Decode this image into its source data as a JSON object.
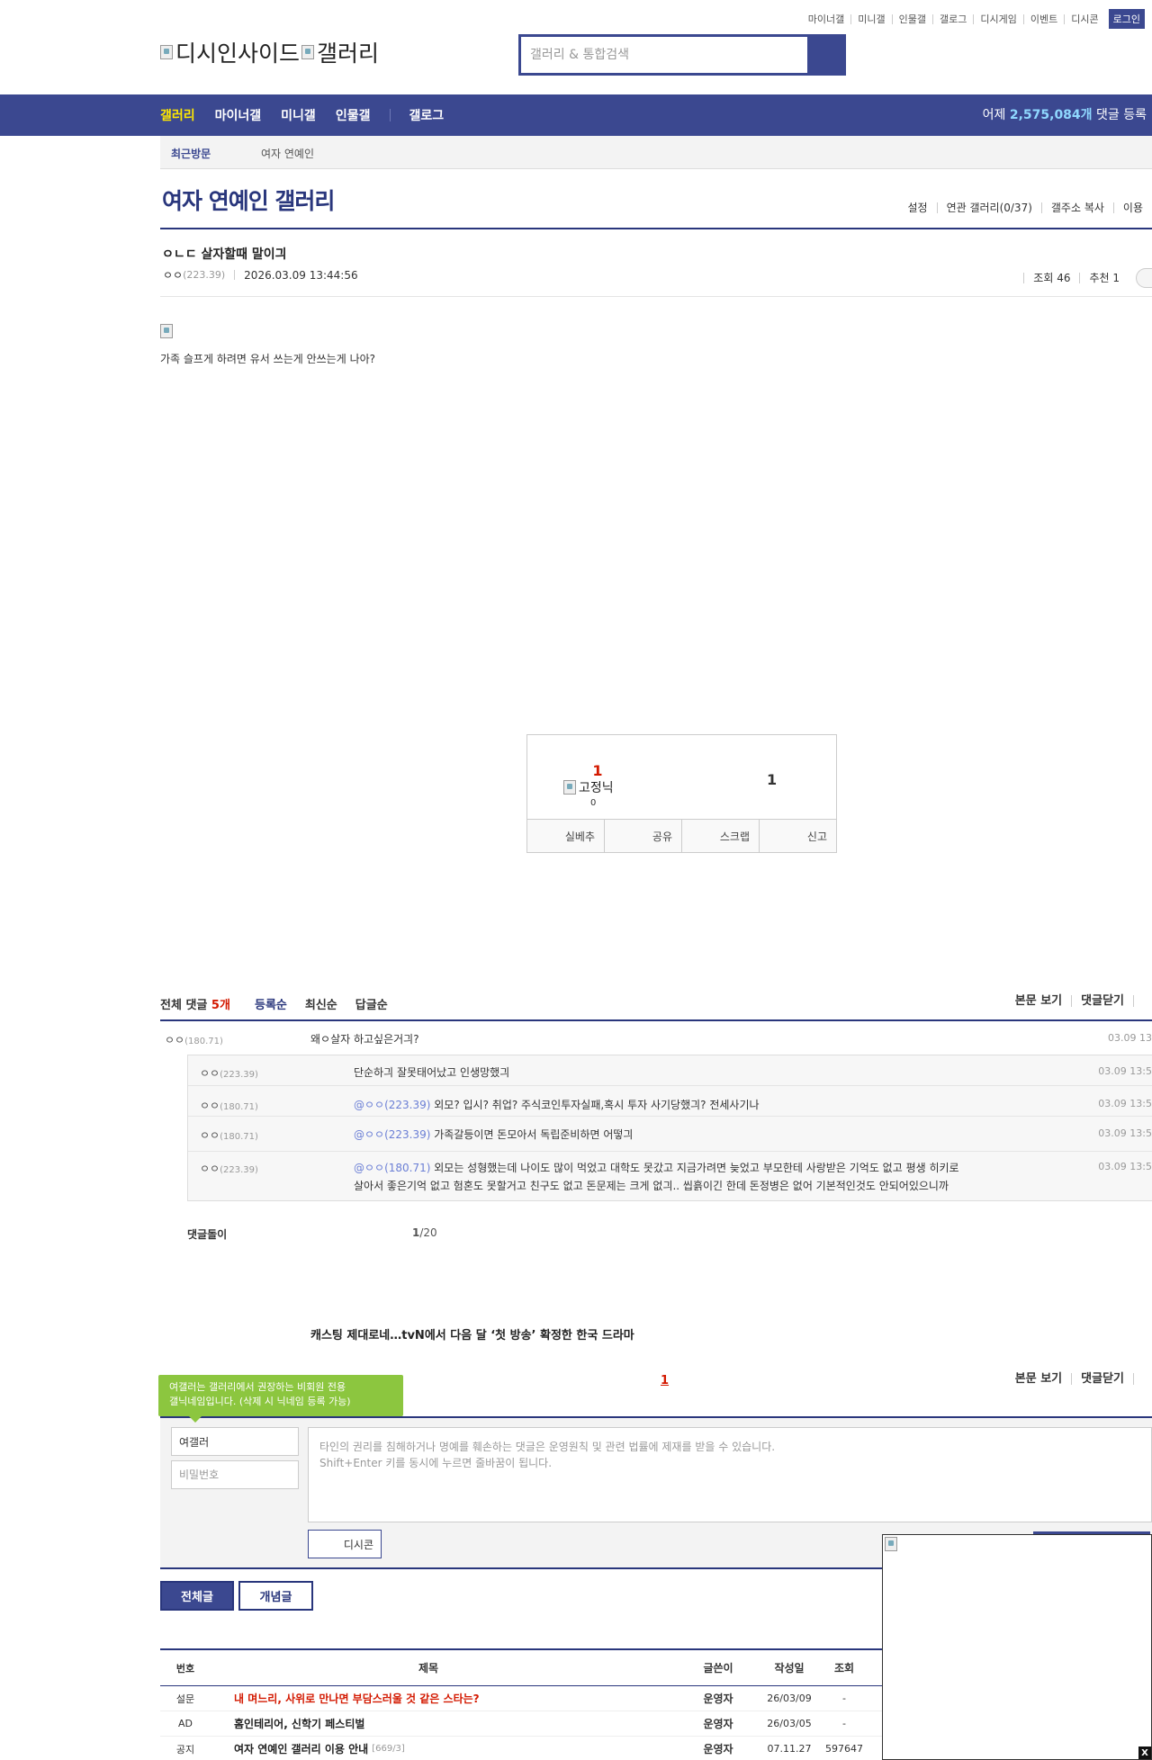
{
  "util_links": [
    "마이너갤",
    "미니갤",
    "인물갤",
    "갤로그",
    "디시게임",
    "이벤트",
    "디시콘"
  ],
  "login_label": "로그인",
  "logo": {
    "part1": "디시인사이드",
    "part2": "갤러리"
  },
  "search": {
    "placeholder": "갤러리 & 통합검색"
  },
  "gnb": {
    "menu": [
      "갤러리",
      "마이너갤",
      "미니갤",
      "인물갤"
    ],
    "gallog": "갤로그",
    "stat_prefix": "어제",
    "stat_num": "2,575,084개",
    "stat_suffix": "댓글 등록"
  },
  "recent": {
    "label": "최근방문",
    "item": "여자 연예인"
  },
  "gallery": {
    "title": "여자 연예인 갤러리",
    "tools": [
      "설정",
      "연관 갤러리(0/37)",
      "갤주소 복사",
      "이용"
    ]
  },
  "post": {
    "title": "ㅇㄴㄷ 살자할때 말이긔",
    "nick": "ㅇㅇ",
    "ip": "(223.39)",
    "date": "2026.03.09 13:44:56",
    "views": "조회 46",
    "recommend": "추천 1",
    "body": "가족 슬프게 하려면 유서 쓰는게 안쓰는게 나아?"
  },
  "rec": {
    "up": "1",
    "fix_alt": "고정닉",
    "fix_count": "0",
    "down": "1",
    "actions": [
      "실베추",
      "공유",
      "스크랩",
      "신고"
    ]
  },
  "comments_head": {
    "total_label": "전체 댓글",
    "total_count": "5개",
    "sort": [
      "등록순",
      "최신순",
      "답글순"
    ],
    "right": [
      "본문 보기",
      "댓글닫기"
    ]
  },
  "comments": [
    {
      "nick": "ㅇㅇ",
      "ip": "(180.71)",
      "text": "왜ㅇ살자 하고싶은거긔?",
      "date": "03.09 13"
    },
    {
      "nick": "ㅇㅇ",
      "ip": "(223.39)",
      "at": "",
      "text": "단순하긔 잘못태어났고 인생망했긔",
      "date": "03.09 13:5"
    },
    {
      "nick": "ㅇㅇ",
      "ip": "(180.71)",
      "at": "@ㅇㅇ(223.39)",
      "text": " 외모? 입시? 취업? 주식코인투자실패,혹시 투자 사기당했긔? 전세사기나",
      "date": "03.09 13:5"
    },
    {
      "nick": "ㅇㅇ",
      "ip": "(180.71)",
      "at": "@ㅇㅇ(223.39)",
      "text": " 가족갈등이면 돈모아서 독립준비하면 어떻긔",
      "date": "03.09 13:5"
    },
    {
      "nick": "ㅇㅇ",
      "ip": "(223.39)",
      "at": "@ㅇㅇ(180.71)",
      "text": " 외모는 성형했는데 나이도 많이 먹었고 대학도 못갔고 지금가려면 늦었고 부모한테 사랑받은 기억도 없고 평생 히키로",
      "text2": "살아서 좋은기억 없고 험혼도 못할거고 친구도 없고 돈문제는 크게 없긔.. 씹흙이긴 한데 돈정병은 없어 기본적인것도 안되어있으니까",
      "date": "03.09 13:5"
    }
  ],
  "cmt_paging": {
    "label": "댓글돌이",
    "current": "1",
    "total": "/20"
  },
  "news": "캐스팅 제대로네…tvN에서 다음 달 ‘첫 방송’ 확정한 한국 드라마",
  "cmt_page2": "1",
  "cmt_head2_right": [
    "본문 보기",
    "댓글닫기"
  ],
  "tooltip": {
    "line1": "여갤러는 갤러리에서 권장하는 비회원 전용",
    "line2": "갤닉네임입니다. (삭제 시 닉네임 등록 가능)"
  },
  "write": {
    "name_value": "여갤러",
    "pw_placeholder": "비밀번호",
    "textarea_placeholder": "타인의 권리를 침해하거나 명예를 훼손하는 댓글은 운영원칙 및 관련 법률에 제재를 받을 수 있습니다.\nShift+Enter 키를 동시에 누르면 줄바꿈이 됩니다.",
    "dccon_label": "디시콘"
  },
  "list_tabs": {
    "all": "전체글",
    "best": "개념글"
  },
  "list": {
    "headers": {
      "no": "번호",
      "title": "제목",
      "writer": "글쓴이",
      "date": "작성일",
      "views": "조회"
    },
    "rows": [
      {
        "no": "설문",
        "title": "내 며느리, 사위로 만나면 부담스러울 것 같은 스타는?",
        "cnt": "",
        "writer": "운영자",
        "date": "26/03/09",
        "views": "-"
      },
      {
        "no": "AD",
        "title": "홈인테리어, 신학기 페스티벌",
        "cnt": "",
        "writer": "운영자",
        "date": "26/03/05",
        "views": "-"
      },
      {
        "no": "공지",
        "title": "여자 연예인 갤러리 이용 안내",
        "cnt": "[669/3]",
        "writer": "운영자",
        "date": "07.11.27",
        "views": "597647"
      }
    ]
  },
  "ad_close": "X"
}
